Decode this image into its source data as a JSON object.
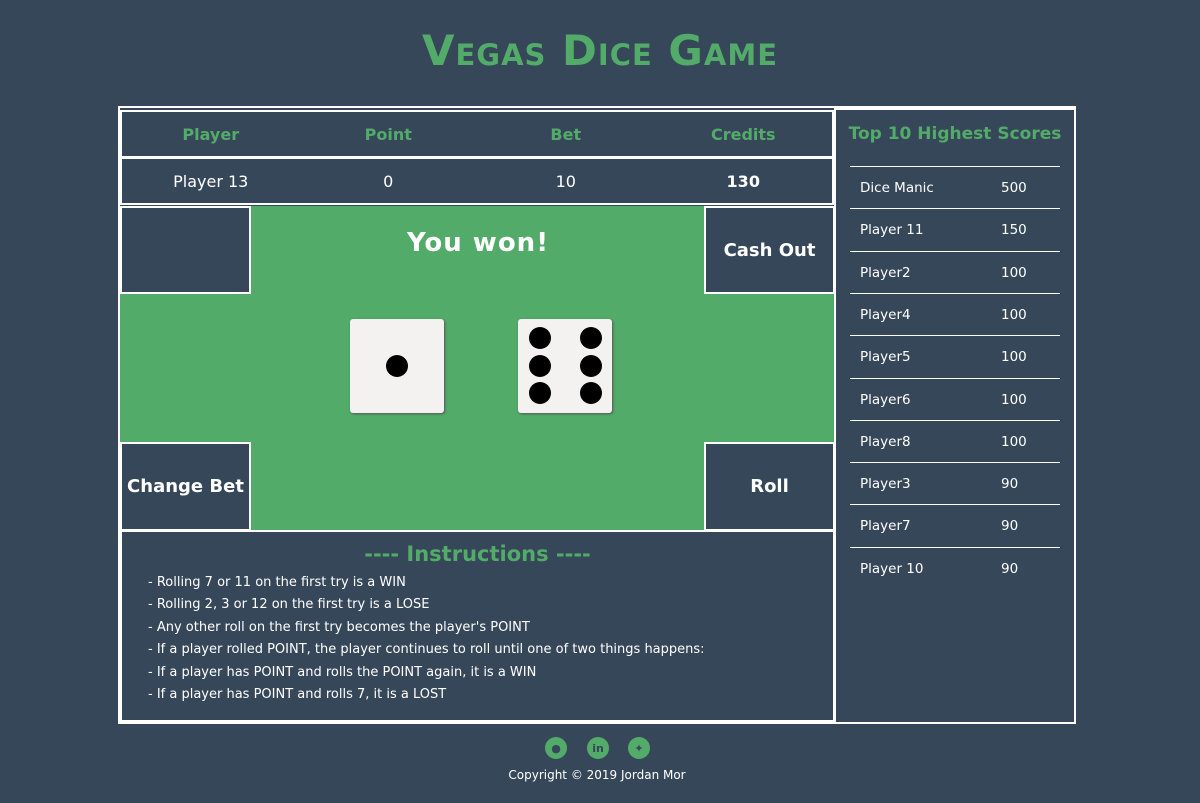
{
  "title": "Vegas Dice Game",
  "table": {
    "headers": [
      "Player",
      "Point",
      "Bet",
      "Credits"
    ],
    "values": [
      "Player 13",
      "0",
      "10",
      "130"
    ]
  },
  "board": {
    "message": "You won!",
    "cash_out": "Cash Out",
    "change_bet": "Change Bet",
    "roll": "Roll",
    "dice": [
      1,
      6
    ]
  },
  "instructions": {
    "title": "---- Instructions ----",
    "lines": [
      "- Rolling 7 or 11 on the first try is a WIN",
      "- Rolling 2, 3 or 12 on the first try is a LOSE",
      "- Any other roll on the first try becomes the player's POINT",
      "- If a player rolled POINT, the player continues to roll until one of two things happens:",
      "- If a player has POINT and rolls the POINT again, it is a WIN",
      "- If a player has POINT and rolls 7, it is a LOST"
    ]
  },
  "scores": {
    "title": "Top 10 Highest Scores",
    "rows": [
      [
        "Dice Manic",
        "500"
      ],
      [
        "Player 11",
        "150"
      ],
      [
        "Player2",
        "100"
      ],
      [
        "Player4",
        "100"
      ],
      [
        "Player5",
        "100"
      ],
      [
        "Player6",
        "100"
      ],
      [
        "Player8",
        "100"
      ],
      [
        "Player3",
        "90"
      ],
      [
        "Player7",
        "90"
      ],
      [
        "Player 10",
        "90"
      ]
    ]
  },
  "footer": {
    "icons": [
      "github-icon",
      "linkedin-icon",
      "twitter-icon"
    ],
    "copyright": "Copyright © 2019 Jordan Mor"
  },
  "colors": {
    "background": "#37475a",
    "accent": "#52ab68"
  }
}
